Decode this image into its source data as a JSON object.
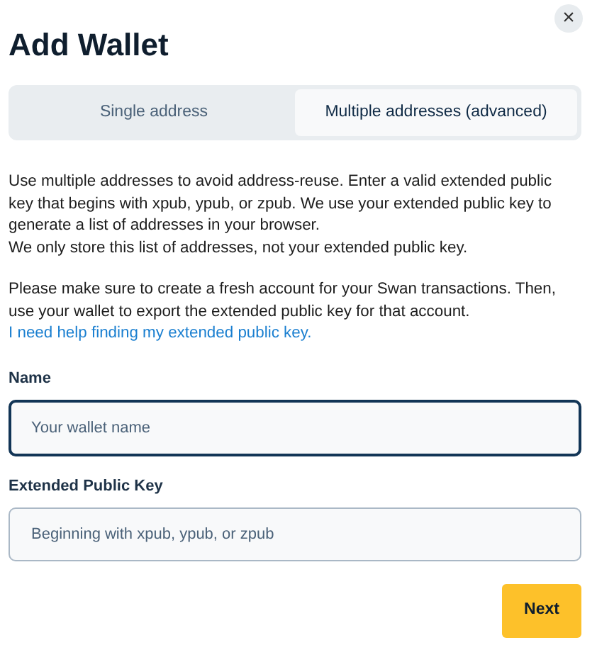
{
  "title": "Add Wallet",
  "close": {
    "label": "×"
  },
  "tabs": [
    {
      "label": "Single address",
      "selected": false
    },
    {
      "label": "Multiple addresses (advanced)",
      "selected": true
    }
  ],
  "intro": [
    "Use multiple addresses to avoid address-reuse. Enter a valid extended public key that begins with xpub, ypub, or zpub. We use your extended public key to generate a list of addresses in your browser.",
    "We only store this list of addresses, not your extended public key."
  ],
  "note": {
    "text": "Please make sure to create a fresh account for your Swan transactions. Then, use your wallet to export the extended public key for that account. ",
    "link": "I need help finding my extended public key."
  },
  "fields": [
    {
      "label": "Name",
      "placeholder": "Your wallet name",
      "focused": true
    },
    {
      "label": "Extended Public Key",
      "placeholder": "Beginning with xpub, ypub, or zpub",
      "focused": false
    }
  ],
  "next_button": "Next"
}
